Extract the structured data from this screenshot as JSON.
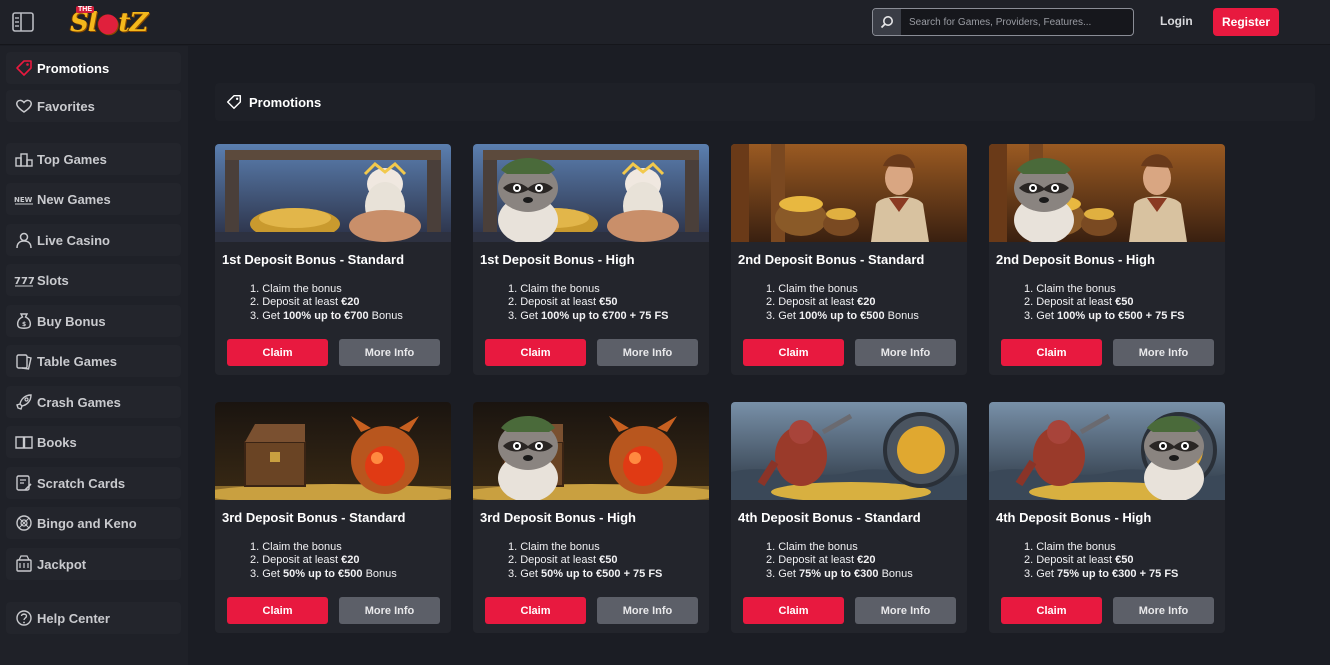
{
  "header": {
    "logo_the": "THE",
    "logo_word_a": "Sl",
    "logo_word_b": "t",
    "logo_word_c": "Z",
    "search_placeholder": "Search for Games, Providers, Features...",
    "login_label": "Login",
    "register_label": "Register"
  },
  "sidebar": {
    "items": [
      {
        "label": "Promotions",
        "icon": "tag-icon"
      },
      {
        "label": "Favorites",
        "icon": "heart-icon"
      },
      {
        "label": "Top Games",
        "icon": "podium-icon"
      },
      {
        "label": "New Games",
        "icon": "new-badge-icon"
      },
      {
        "label": "Live Casino",
        "icon": "person-icon"
      },
      {
        "label": "Slots",
        "icon": "slots-icon"
      },
      {
        "label": "Buy Bonus",
        "icon": "money-bag-icon"
      },
      {
        "label": "Table Games",
        "icon": "cards-icon"
      },
      {
        "label": "Crash Games",
        "icon": "rocket-icon"
      },
      {
        "label": "Books",
        "icon": "book-icon"
      },
      {
        "label": "Scratch Cards",
        "icon": "scratch-card-icon"
      },
      {
        "label": "Bingo and Keno",
        "icon": "bingo-ball-icon"
      },
      {
        "label": "Jackpot",
        "icon": "jackpot-icon"
      },
      {
        "label": "Help Center",
        "icon": "help-icon"
      }
    ]
  },
  "main": {
    "title": "Promotions",
    "step1": "Claim the bonus",
    "deposit_prefix": "Deposit at least",
    "get_prefix": "Get",
    "claim_label": "Claim",
    "more_label": "More Info",
    "cards": [
      {
        "title": "1st Deposit Bonus - Standard",
        "deposit": "€20",
        "offer": "100% up to €700",
        "suffix": " Bonus",
        "theme": "zeus"
      },
      {
        "title": "1st Deposit Bonus - High",
        "deposit": "€50",
        "offer": "100% up to €700 + 75 FS",
        "suffix": "",
        "theme": "zeus-raccoon"
      },
      {
        "title": "2nd Deposit Bonus - Standard",
        "deposit": "€20",
        "offer": "100% up to €500",
        "suffix": " Bonus",
        "theme": "explorer"
      },
      {
        "title": "2nd Deposit Bonus - High",
        "deposit": "€50",
        "offer": "100% up to €500 + 75 FS",
        "suffix": "",
        "theme": "explorer-raccoon"
      },
      {
        "title": "3rd Deposit Bonus - Standard",
        "deposit": "€20",
        "offer": "50% up to €500",
        "suffix": " Bonus",
        "theme": "treasure"
      },
      {
        "title": "3rd Deposit Bonus - High",
        "deposit": "€50",
        "offer": "50% up to €500 + 75 FS",
        "suffix": "",
        "theme": "treasure-raccoon"
      },
      {
        "title": "4th Deposit Bonus - Standard",
        "deposit": "€20",
        "offer": "75% up to €300",
        "suffix": " Bonus",
        "theme": "vault"
      },
      {
        "title": "4th Deposit Bonus - High",
        "deposit": "€50",
        "offer": "75% up to €300 + 75 FS",
        "suffix": "",
        "theme": "vault-raccoon"
      }
    ]
  },
  "colors": {
    "accent": "#e8193f",
    "background": "#1b1d24",
    "panel": "#23252c",
    "secondary_button": "#5c5f68"
  }
}
